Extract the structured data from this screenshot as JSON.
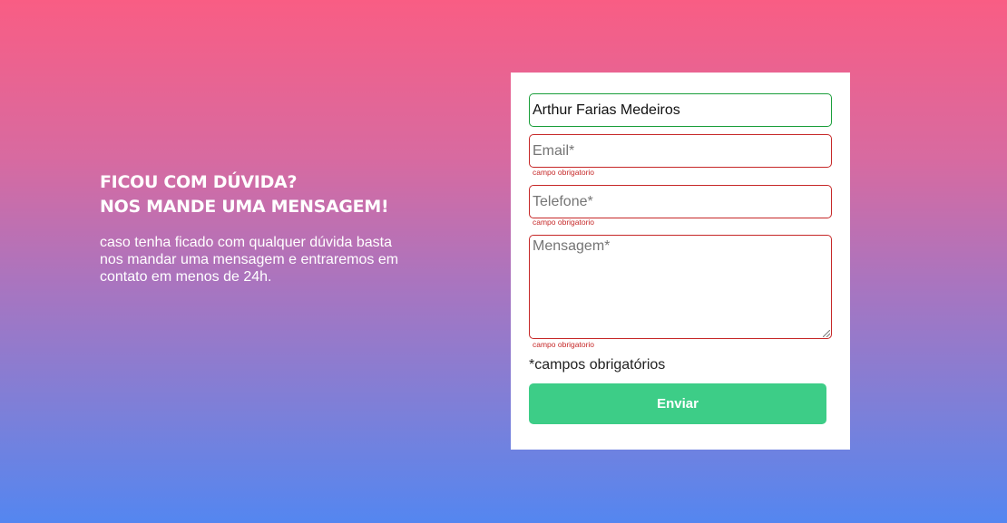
{
  "intro": {
    "title_line1": "FICOU COM DÚVIDA?",
    "title_line2": "NOS MANDE UMA MENSAGEM!",
    "description": "caso tenha ficado com qualquer dúvida basta nos mandar uma mensagem e entraremos em contato em menos de 24h."
  },
  "form": {
    "name": {
      "value": "Arthur Farias Medeiros",
      "status": "valid"
    },
    "email": {
      "value": "",
      "placeholder": "Email*",
      "status": "invalid",
      "error": "campo obrigatorio"
    },
    "phone": {
      "value": "",
      "placeholder": "Telefone*",
      "status": "invalid",
      "error": "campo obrigatorio"
    },
    "message": {
      "value": "",
      "placeholder": "Mensagem*",
      "status": "invalid",
      "error": "campo obrigatorio"
    },
    "required_note": "*campos obrigatórios",
    "submit_label": "Enviar"
  },
  "colors": {
    "gradient_top": "#f95d84",
    "gradient_bottom": "#5486f0",
    "valid_border": "#1a9e3a",
    "invalid_border": "#c62828",
    "submit_bg": "#3dcd87"
  }
}
